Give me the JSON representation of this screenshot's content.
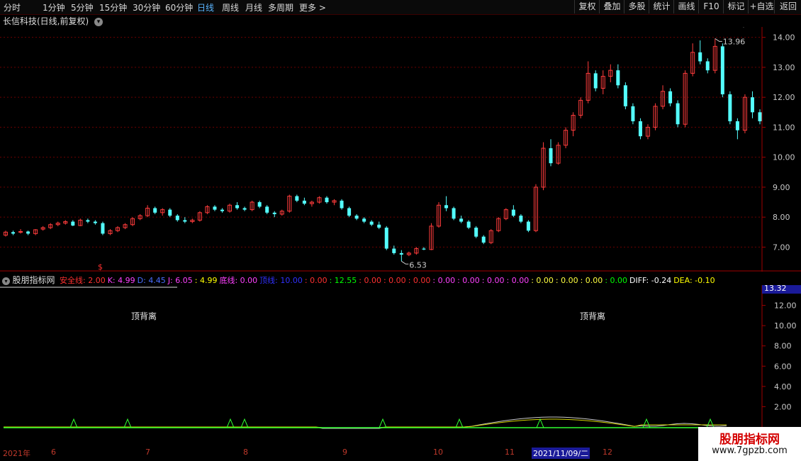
{
  "toolbar": {
    "periods": [
      "分时",
      "1分钟",
      "5分钟",
      "15分钟",
      "30分钟",
      "60分钟",
      "日线",
      "周线",
      "月线",
      "多周期",
      "更多 >"
    ],
    "active_period": "日线",
    "right_buttons": [
      "复权",
      "叠加",
      "多股",
      "统计",
      "画线",
      "F10",
      "标记",
      "+自选",
      "返回"
    ]
  },
  "stock_title": "长信科技(日线,前复权)",
  "price_axis": {
    "labels": [
      "14.00",
      "13.00",
      "12.00",
      "11.00",
      "10.00",
      "9.00",
      "8.00",
      "7.00"
    ],
    "min": 6.3,
    "max": 14.3
  },
  "annotations": {
    "high": "13.96",
    "low": "6.53",
    "signal": "$"
  },
  "indicator": {
    "name": "股朋指标网",
    "items": [
      {
        "label": "安全线: 2.00",
        "color": "#ff3030"
      },
      {
        "label": "K: 4.99",
        "color": "#ff40ff"
      },
      {
        "label": "D: 4.45",
        "color": "#4a6dff"
      },
      {
        "label": "J: 6.05",
        "color": "#ff40ff"
      },
      {
        "label": ": 4.99",
        "color": "#ffff00"
      },
      {
        "label": "底线: 0.00",
        "color": "#ff40ff"
      },
      {
        "label": "顶线: 10.00",
        "color": "#3030ff"
      },
      {
        "label": ": 0.00",
        "color": "#ff3030"
      },
      {
        "label": ": 12.55",
        "color": "#00ff00"
      },
      {
        "label": ": 0.00",
        "color": "#ff3030"
      },
      {
        "label": ": 0.00",
        "color": "#ff3030"
      },
      {
        "label": ": 0.00",
        "color": "#ff3030"
      },
      {
        "label": ": 0.00",
        "color": "#ff40ff"
      },
      {
        "label": ": 0.00",
        "color": "#ff40ff"
      },
      {
        "label": ": 0.00",
        "color": "#ff40ff"
      },
      {
        "label": ": 0.00",
        "color": "#ff40ff"
      },
      {
        "label": ": 0.00",
        "color": "#ffff40"
      },
      {
        "label": ": 0.00",
        "color": "#ffff40"
      },
      {
        "label": ": 0.00",
        "color": "#ffff40"
      },
      {
        "label": ": 0.00",
        "color": "#00ff00"
      },
      {
        "label": "DIFF: -0.24",
        "color": "#ffffff"
      },
      {
        "label": "DEA: -0.10",
        "color": "#ffff00"
      }
    ],
    "axis_labels": [
      "12.00",
      "10.00",
      "8.00",
      "6.00",
      "4.00",
      "2.00"
    ],
    "current_value": "13.32",
    "divergence_labels": [
      "顶背离",
      "顶背离"
    ]
  },
  "date_axis": {
    "labels": [
      "2021年",
      "6",
      "7",
      "8",
      "9",
      "10",
      "11",
      "2021/11/09/二",
      "12"
    ]
  },
  "watermark": {
    "line1": "股朋指标网",
    "line2": "www.7gpzb.com"
  },
  "colors": {
    "up": "#ff3c3c",
    "down": "#54ffff",
    "grid": "#6b0000",
    "axis": "#a00000"
  },
  "chart_data": {
    "type": "candlestick",
    "ohlc": [
      [
        7.4,
        7.55,
        7.35,
        7.5
      ],
      [
        7.5,
        7.55,
        7.4,
        7.45
      ],
      [
        7.5,
        7.6,
        7.45,
        7.52
      ],
      [
        7.52,
        7.55,
        7.4,
        7.45
      ],
      [
        7.45,
        7.6,
        7.4,
        7.58
      ],
      [
        7.6,
        7.7,
        7.55,
        7.65
      ],
      [
        7.65,
        7.8,
        7.6,
        7.75
      ],
      [
        7.75,
        7.85,
        7.7,
        7.8
      ],
      [
        7.8,
        7.9,
        7.75,
        7.85
      ],
      [
        7.85,
        7.9,
        7.7,
        7.72
      ],
      [
        7.72,
        7.95,
        7.7,
        7.9
      ],
      [
        7.9,
        7.95,
        7.8,
        7.85
      ],
      [
        7.85,
        7.9,
        7.75,
        7.8
      ],
      [
        7.8,
        7.85,
        7.4,
        7.45
      ],
      [
        7.45,
        7.6,
        7.4,
        7.55
      ],
      [
        7.55,
        7.7,
        7.5,
        7.65
      ],
      [
        7.65,
        7.8,
        7.6,
        7.75
      ],
      [
        7.75,
        8.0,
        7.7,
        7.95
      ],
      [
        7.95,
        8.1,
        7.9,
        8.05
      ],
      [
        8.05,
        8.4,
        8.0,
        8.3
      ],
      [
        8.3,
        8.35,
        8.1,
        8.15
      ],
      [
        8.15,
        8.3,
        8.05,
        8.25
      ],
      [
        8.25,
        8.3,
        8.0,
        8.05
      ],
      [
        8.05,
        8.1,
        7.85,
        7.9
      ],
      [
        7.9,
        8.0,
        7.8,
        7.85
      ],
      [
        7.85,
        7.95,
        7.8,
        7.9
      ],
      [
        7.9,
        8.2,
        7.85,
        8.15
      ],
      [
        8.15,
        8.4,
        8.1,
        8.35
      ],
      [
        8.35,
        8.4,
        8.2,
        8.25
      ],
      [
        8.25,
        8.3,
        8.15,
        8.2
      ],
      [
        8.2,
        8.45,
        8.15,
        8.4
      ],
      [
        8.4,
        8.5,
        8.25,
        8.3
      ],
      [
        8.3,
        8.35,
        8.2,
        8.25
      ],
      [
        8.25,
        8.55,
        8.2,
        8.5
      ],
      [
        8.5,
        8.55,
        8.3,
        8.35
      ],
      [
        8.35,
        8.4,
        8.1,
        8.15
      ],
      [
        8.15,
        8.2,
        8.0,
        8.1
      ],
      [
        8.1,
        8.25,
        8.05,
        8.2
      ],
      [
        8.2,
        8.75,
        8.15,
        8.7
      ],
      [
        8.7,
        8.75,
        8.5,
        8.55
      ],
      [
        8.55,
        8.65,
        8.4,
        8.45
      ],
      [
        8.45,
        8.55,
        8.35,
        8.5
      ],
      [
        8.5,
        8.7,
        8.45,
        8.65
      ],
      [
        8.65,
        8.7,
        8.45,
        8.5
      ],
      [
        8.5,
        8.6,
        8.4,
        8.55
      ],
      [
        8.55,
        8.6,
        8.25,
        8.3
      ],
      [
        8.3,
        8.35,
        8.0,
        8.05
      ],
      [
        8.05,
        8.1,
        7.9,
        7.95
      ],
      [
        7.95,
        8.0,
        7.8,
        7.85
      ],
      [
        7.85,
        7.9,
        7.7,
        7.75
      ],
      [
        7.75,
        7.85,
        7.6,
        7.65
      ],
      [
        7.65,
        7.7,
        6.9,
        6.95
      ],
      [
        6.95,
        7.05,
        6.75,
        6.8
      ],
      [
        6.8,
        6.9,
        6.53,
        6.75
      ],
      [
        6.75,
        6.85,
        6.7,
        6.8
      ],
      [
        6.8,
        7.0,
        6.75,
        6.95
      ],
      [
        6.95,
        7.0,
        6.9,
        6.92
      ],
      [
        6.92,
        7.8,
        6.9,
        7.7
      ],
      [
        7.7,
        8.5,
        7.65,
        8.4
      ],
      [
        8.4,
        8.7,
        8.2,
        8.3
      ],
      [
        8.3,
        8.35,
        7.9,
        7.95
      ],
      [
        7.95,
        8.05,
        7.8,
        7.85
      ],
      [
        7.85,
        7.9,
        7.6,
        7.65
      ],
      [
        7.65,
        7.7,
        7.3,
        7.35
      ],
      [
        7.35,
        7.4,
        7.1,
        7.15
      ],
      [
        7.15,
        7.6,
        7.1,
        7.55
      ],
      [
        7.55,
        8.0,
        7.5,
        7.95
      ],
      [
        7.95,
        8.3,
        7.9,
        8.25
      ],
      [
        8.25,
        8.4,
        8.0,
        8.05
      ],
      [
        8.05,
        8.1,
        7.8,
        7.85
      ],
      [
        7.85,
        7.9,
        7.5,
        7.55
      ],
      [
        7.55,
        9.1,
        7.5,
        9.0
      ],
      [
        9.0,
        10.5,
        8.9,
        10.3
      ],
      [
        10.3,
        10.6,
        9.7,
        9.8
      ],
      [
        9.8,
        10.5,
        9.75,
        10.4
      ],
      [
        10.4,
        11.0,
        10.3,
        10.9
      ],
      [
        10.9,
        11.5,
        10.7,
        11.4
      ],
      [
        11.4,
        12.0,
        11.3,
        11.9
      ],
      [
        11.9,
        13.2,
        11.8,
        12.8
      ],
      [
        12.8,
        12.9,
        12.2,
        12.3
      ],
      [
        12.3,
        12.9,
        12.1,
        12.7
      ],
      [
        12.7,
        13.1,
        12.5,
        12.9
      ],
      [
        12.9,
        13.1,
        12.3,
        12.4
      ],
      [
        12.4,
        12.5,
        11.6,
        11.7
      ],
      [
        11.7,
        11.8,
        11.1,
        11.2
      ],
      [
        11.2,
        11.3,
        10.6,
        10.7
      ],
      [
        10.7,
        11.1,
        10.6,
        11.0
      ],
      [
        11.0,
        11.8,
        10.9,
        11.7
      ],
      [
        11.7,
        12.4,
        11.6,
        12.2
      ],
      [
        12.2,
        12.3,
        11.7,
        11.8
      ],
      [
        11.8,
        11.9,
        11.0,
        11.1
      ],
      [
        11.1,
        12.9,
        11.0,
        12.8
      ],
      [
        12.8,
        13.8,
        12.7,
        13.5
      ],
      [
        13.5,
        13.9,
        13.1,
        13.2
      ],
      [
        13.2,
        13.3,
        12.8,
        12.9
      ],
      [
        12.9,
        13.96,
        12.8,
        13.7
      ],
      [
        13.7,
        13.8,
        12.0,
        12.1
      ],
      [
        12.1,
        12.2,
        11.1,
        11.2
      ],
      [
        11.2,
        11.3,
        10.6,
        10.9
      ],
      [
        10.9,
        12.1,
        10.8,
        12.0
      ],
      [
        12.0,
        12.2,
        11.3,
        11.5
      ],
      [
        11.5,
        11.6,
        11.1,
        11.2
      ]
    ],
    "ylim": [
      6.3,
      14.3
    ],
    "price_labels": [
      "14.00",
      "13.00",
      "12.00",
      "11.00",
      "10.00",
      "9.00",
      "8.00",
      "7.00"
    ]
  }
}
